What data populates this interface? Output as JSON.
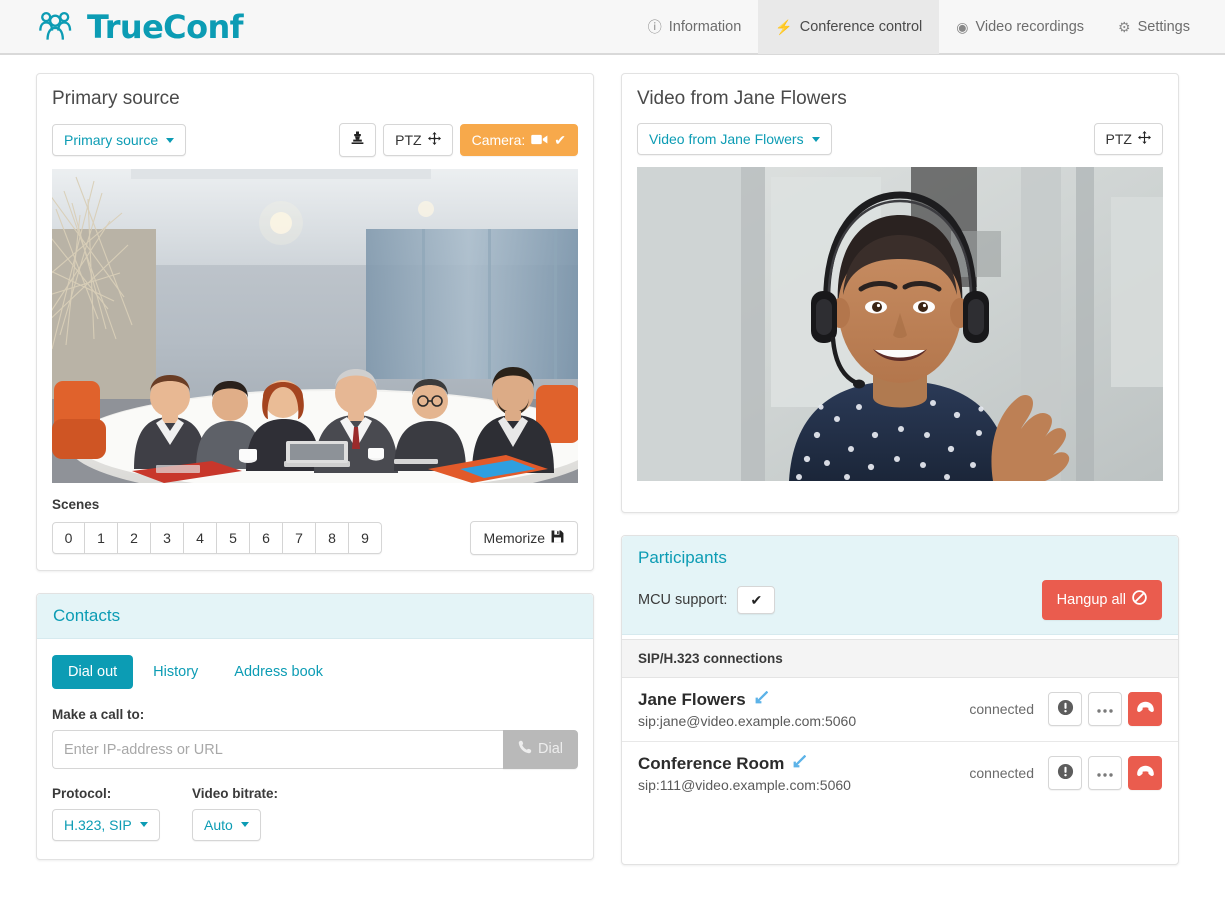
{
  "header": {
    "brand": "TrueConf",
    "nav": [
      {
        "label": "Information",
        "icon": "info-circle-icon",
        "active": false
      },
      {
        "label": "Conference control",
        "icon": "bolt-icon",
        "active": true
      },
      {
        "label": "Video recordings",
        "icon": "record-circle-icon",
        "active": false
      },
      {
        "label": "Settings",
        "icon": "gear-icon",
        "active": false
      }
    ]
  },
  "primary_source": {
    "title": "Primary source",
    "source_select": "Primary source",
    "preset_button_icon": "chess-pawn-icon",
    "ptz_label": "PTZ",
    "camera_label": "Camera:",
    "scenes_label": "Scenes",
    "scenes": [
      "0",
      "1",
      "2",
      "3",
      "4",
      "5",
      "6",
      "7",
      "8",
      "9"
    ],
    "memorize_label": "Memorize"
  },
  "remote_video": {
    "title": "Video from Jane Flowers",
    "source_select": "Video from Jane Flowers",
    "ptz_label": "PTZ"
  },
  "contacts": {
    "title": "Contacts",
    "tabs": [
      {
        "label": "Dial out",
        "active": true
      },
      {
        "label": "History",
        "active": false
      },
      {
        "label": "Address book",
        "active": false
      }
    ],
    "call_label": "Make a call to:",
    "call_placeholder": "Enter IP-address or URL",
    "call_value": "",
    "dial_label": "Dial",
    "protocol_label": "Protocol:",
    "protocol_value": "H.323, SIP",
    "bitrate_label": "Video bitrate:",
    "bitrate_value": "Auto"
  },
  "participants": {
    "title": "Participants",
    "mcu_label": "MCU support:",
    "mcu_checked": true,
    "hangup_all_label": "Hangup all",
    "group_header": "SIP/H.323 connections",
    "rows": [
      {
        "name": "Jane Flowers",
        "direction_icon": "incoming-call-arrow-icon",
        "uri": "sip:jane@video.example.com:5060",
        "status": "connected"
      },
      {
        "name": "Conference Room",
        "direction_icon": "incoming-call-arrow-icon",
        "uri": "sip:111@video.example.com:5060",
        "status": "connected"
      }
    ]
  },
  "colors": {
    "brand_teal": "#0c9cb4",
    "warning_orange": "#f7a94b",
    "danger_red": "#ea5c4e",
    "panel_head_teal_bg": "#e4f4f7",
    "header_bg": "#f7f7f7"
  }
}
